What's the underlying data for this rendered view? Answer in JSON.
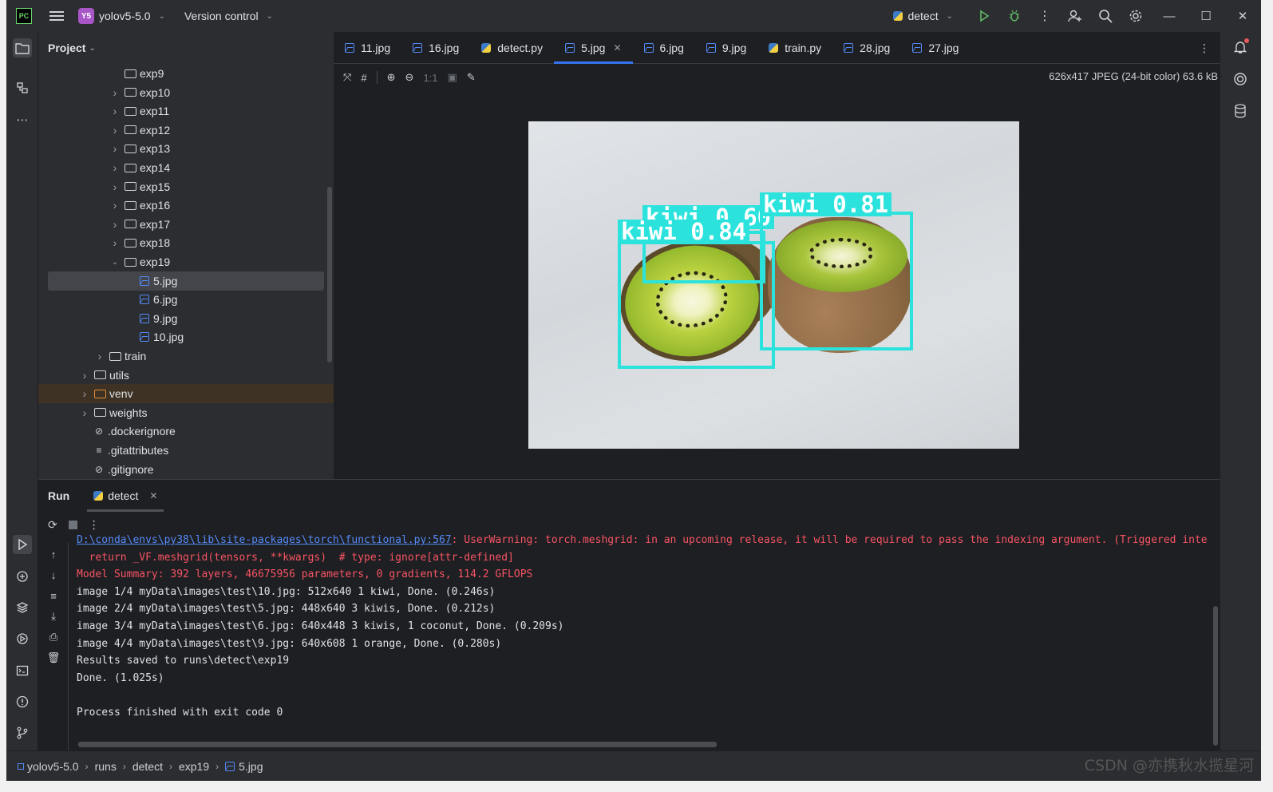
{
  "titlebar": {
    "logo": "PC",
    "project_badge": "Y5",
    "project_name": "yolov5-5.0",
    "version_control": "Version control",
    "run_config": "detect"
  },
  "project_panel": {
    "title": "Project",
    "tree": [
      {
        "label": "exp9",
        "type": "folder",
        "depth": 4,
        "arrow": ""
      },
      {
        "label": "exp10",
        "type": "folder",
        "depth": 4,
        "arrow": "›"
      },
      {
        "label": "exp11",
        "type": "folder",
        "depth": 4,
        "arrow": "›"
      },
      {
        "label": "exp12",
        "type": "folder",
        "depth": 4,
        "arrow": "›"
      },
      {
        "label": "exp13",
        "type": "folder",
        "depth": 4,
        "arrow": "›"
      },
      {
        "label": "exp14",
        "type": "folder",
        "depth": 4,
        "arrow": "›"
      },
      {
        "label": "exp15",
        "type": "folder",
        "depth": 4,
        "arrow": "›"
      },
      {
        "label": "exp16",
        "type": "folder",
        "depth": 4,
        "arrow": "›"
      },
      {
        "label": "exp17",
        "type": "folder",
        "depth": 4,
        "arrow": "›"
      },
      {
        "label": "exp18",
        "type": "folder",
        "depth": 4,
        "arrow": "›"
      },
      {
        "label": "exp19",
        "type": "folder",
        "depth": 4,
        "arrow": "⌄"
      },
      {
        "label": "5.jpg",
        "type": "image",
        "depth": 5,
        "arrow": "",
        "selected": true
      },
      {
        "label": "6.jpg",
        "type": "image",
        "depth": 5,
        "arrow": ""
      },
      {
        "label": "9.jpg",
        "type": "image",
        "depth": 5,
        "arrow": ""
      },
      {
        "label": "10.jpg",
        "type": "image",
        "depth": 5,
        "arrow": ""
      },
      {
        "label": "train",
        "type": "folder",
        "depth": 3,
        "arrow": "›"
      },
      {
        "label": "utils",
        "type": "folder",
        "depth": 2,
        "arrow": "›"
      },
      {
        "label": "venv",
        "type": "folder-excluded",
        "depth": 2,
        "arrow": "›",
        "excluded": true
      },
      {
        "label": "weights",
        "type": "folder",
        "depth": 2,
        "arrow": "›"
      },
      {
        "label": ".dockerignore",
        "type": "ignore",
        "depth": 2,
        "arrow": ""
      },
      {
        "label": ".gitattributes",
        "type": "text",
        "depth": 2,
        "arrow": ""
      },
      {
        "label": ".gitignore",
        "type": "ignore",
        "depth": 2,
        "arrow": ""
      }
    ]
  },
  "editor": {
    "tabs": [
      {
        "label": "11.jpg",
        "type": "image"
      },
      {
        "label": "16.jpg",
        "type": "image"
      },
      {
        "label": "detect.py",
        "type": "python"
      },
      {
        "label": "5.jpg",
        "type": "image",
        "active": true
      },
      {
        "label": "6.jpg",
        "type": "image"
      },
      {
        "label": "9.jpg",
        "type": "image"
      },
      {
        "label": "train.py",
        "type": "python"
      },
      {
        "label": "28.jpg",
        "type": "image"
      },
      {
        "label": "27.jpg",
        "type": "image"
      }
    ],
    "zoom_label": "1:1",
    "image_info": "626x417 JPEG (24-bit color) 63.6 kB",
    "detections": [
      {
        "label": "kiwi 0.60"
      },
      {
        "label": "kiwi 0.84"
      },
      {
        "label": "kiwi 0.81"
      }
    ]
  },
  "run_panel": {
    "title": "Run",
    "tab": "detect",
    "console": {
      "path_link": "D:\\conda\\envs\\py38\\lib\\site-packages\\torch\\functional.py:567",
      "warning_rest": ": UserWarning: torch.meshgrid: in an upcoming release, it will be required to pass the indexing argument. (Triggered inte",
      "lines": [
        {
          "text": "  return _VF.meshgrid(tensors, **kwargs)  # type: ignore[attr-defined]",
          "kind": "err"
        },
        {
          "text": "Model Summary: 392 layers, 46675956 parameters, 0 gradients, 114.2 GFLOPS",
          "kind": "err"
        },
        {
          "text": "image 1/4 myData\\images\\test\\10.jpg: 512x640 1 kiwi, Done. (0.246s)",
          "kind": "norm"
        },
        {
          "text": "image 2/4 myData\\images\\test\\5.jpg: 448x640 3 kiwis, Done. (0.212s)",
          "kind": "norm"
        },
        {
          "text": "image 3/4 myData\\images\\test\\6.jpg: 640x448 3 kiwis, 1 coconut, Done. (0.209s)",
          "kind": "norm"
        },
        {
          "text": "image 4/4 myData\\images\\test\\9.jpg: 640x608 1 orange, Done. (0.280s)",
          "kind": "norm"
        },
        {
          "text": "Results saved to runs\\detect\\exp19",
          "kind": "norm"
        },
        {
          "text": "Done. (1.025s)",
          "kind": "norm"
        },
        {
          "text": "",
          "kind": "norm"
        },
        {
          "text": "Process finished with exit code 0",
          "kind": "norm"
        }
      ]
    }
  },
  "statusbar": {
    "breadcrumb": [
      "yolov5-5.0",
      "runs",
      "detect",
      "exp19",
      "5.jpg"
    ]
  },
  "watermark": "CSDN @亦携秋水揽星河",
  "colors": {
    "accent": "#3574f0",
    "detection_box": "#2be3dc",
    "error_text": "#f75464"
  }
}
